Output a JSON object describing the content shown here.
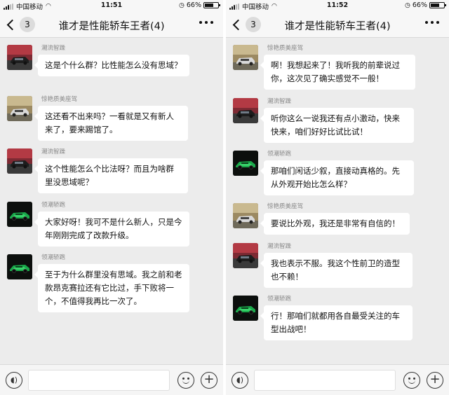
{
  "panels": [
    {
      "status": {
        "carrier": "中国移动",
        "time": "11:51",
        "battery": "66%"
      },
      "header": {
        "back_count": "3",
        "title": "谁才是性能轿车王者(4)"
      },
      "messages": [
        {
          "sender": "潮流智躁",
          "avatar": "sedan-dark",
          "text": "这是个什么群？比性能怎么没有思域？"
        },
        {
          "sender": "惊艳质美座驾",
          "avatar": "sedan-silver",
          "text": "这还看不出来吗？一看就是又有新人来了，要来踢馆了。"
        },
        {
          "sender": "潮流智躁",
          "avatar": "sedan-dark",
          "text": "这个性能怎么个比法呀？而且为啥群里没思域呢？"
        },
        {
          "sender": "领潮轿跑",
          "avatar": "sedan-green",
          "text": "大家好呀！我可不是什么新人，只是今年刚刚完成了改款升级。"
        },
        {
          "sender": "领潮轿跑",
          "avatar": "sedan-green",
          "text": "至于为什么群里没有思域。我之前和老款昂克赛拉还有它比过，手下败将一个，不值得我再比一次了。"
        }
      ]
    },
    {
      "status": {
        "carrier": "中国移动",
        "time": "11:52",
        "battery": "66%"
      },
      "header": {
        "back_count": "3",
        "title": "谁才是性能轿车王者(4)"
      },
      "messages": [
        {
          "sender": "惊艳质美座驾",
          "avatar": "sedan-silver",
          "text": "啊！我想起来了！我听我的前辈说过你，这次见了确实感觉不一般！"
        },
        {
          "sender": "潮流智躁",
          "avatar": "sedan-dark",
          "text": "听你这么一说我还有点小激动，快来快来，咱们好好比试比试！"
        },
        {
          "sender": "领潮轿跑",
          "avatar": "sedan-green",
          "text": "那咱们闲话少叙，直接动真格的。先从外观开始比怎么样？"
        },
        {
          "sender": "惊艳质美座驾",
          "avatar": "sedan-silver",
          "text": "要说比外观，我还是非常有自信的！"
        },
        {
          "sender": "潮流智躁",
          "avatar": "sedan-dark",
          "text": "我也表示不服。我这个性前卫的造型也不赖！"
        },
        {
          "sender": "领潮轿跑",
          "avatar": "sedan-green",
          "text": "行！那咱们就都用各自最受关注的车型出战吧！"
        }
      ]
    }
  ],
  "battery_level": 0.66,
  "icons": [
    "back-chevron-icon",
    "more-dots-icon",
    "voice-icon",
    "emoji-icon",
    "plus-icon",
    "wifi-icon",
    "signal-icon",
    "battery-icon"
  ]
}
